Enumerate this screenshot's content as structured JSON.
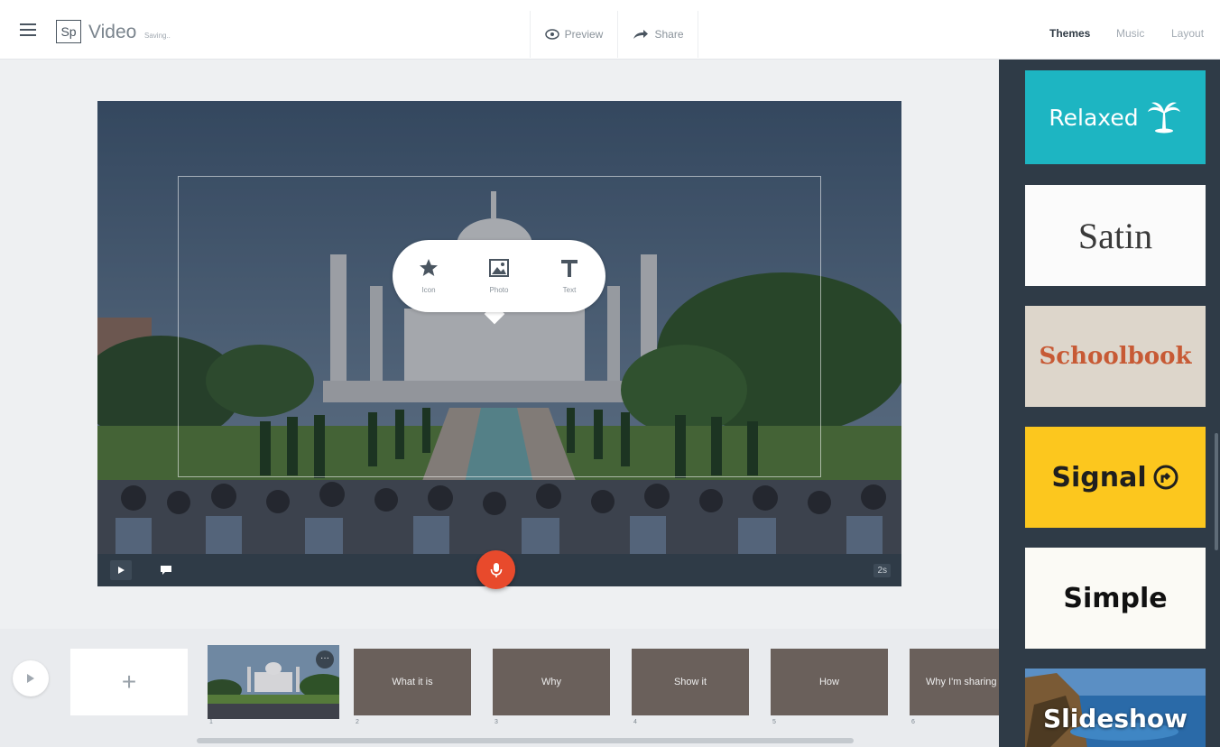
{
  "header": {
    "logo": "Sp",
    "title": "Video",
    "status": "Saving..",
    "preview_label": "Preview",
    "share_label": "Share",
    "tabs": [
      {
        "label": "Themes",
        "active": true
      },
      {
        "label": "Music",
        "active": false
      },
      {
        "label": "Layout",
        "active": false
      }
    ]
  },
  "stage": {
    "popup": {
      "icon_label": "Icon",
      "photo_label": "Photo",
      "text_label": "Text"
    },
    "duration": "2s",
    "icons": {
      "play": "play-icon",
      "caption": "caption-icon",
      "mic": "microphone-icon"
    }
  },
  "themes": {
    "items": [
      {
        "name": "Relaxed",
        "color": "#1db5c2",
        "icon": "palm-tree-icon"
      },
      {
        "name": "Satin",
        "color": "#fbfbfb"
      },
      {
        "name": "Schoolbook",
        "color": "#ddd6cb",
        "text_color": "#c75a35"
      },
      {
        "name": "Signal",
        "color": "#fcc71e",
        "icon": "arrow-circle-icon"
      },
      {
        "name": "Simple",
        "color": "#fbfaf5"
      },
      {
        "name": "Slideshow",
        "color": "#1d4f80"
      }
    ]
  },
  "timeline": {
    "add_label": "+",
    "more_label": "···",
    "slides": [
      {
        "label": "",
        "number": "1"
      },
      {
        "label": "What it is",
        "number": "2"
      },
      {
        "label": "Why",
        "number": "3"
      },
      {
        "label": "Show it",
        "number": "4"
      },
      {
        "label": "How",
        "number": "5"
      },
      {
        "label": "Why I'm sharing",
        "number": "6"
      }
    ]
  },
  "colors": {
    "accent": "#e84a2c",
    "panel": "#2f3b47",
    "slide_bg": "#6a605b"
  }
}
